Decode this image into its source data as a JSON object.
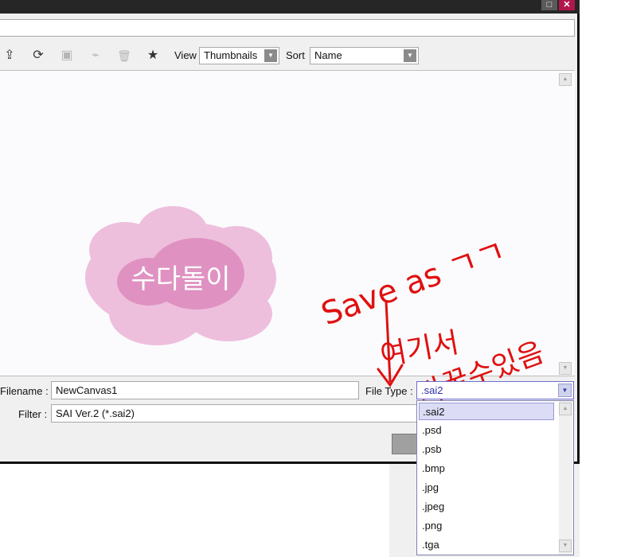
{
  "window": {
    "maximize_glyph": "□",
    "close_glyph": "✕"
  },
  "toolbar": {
    "icons": [
      {
        "name": "export-icon",
        "glyph": "⇪",
        "disabled": false
      },
      {
        "name": "refresh-icon",
        "glyph": "⟳",
        "disabled": false
      },
      {
        "name": "new-folder-icon",
        "glyph": "▣",
        "disabled": true
      },
      {
        "name": "clear-icon",
        "glyph": "⌁",
        "disabled": true
      },
      {
        "name": "trash-icon",
        "glyph": "🗑",
        "disabled": true
      },
      {
        "name": "star-icon",
        "glyph": "★",
        "disabled": false
      }
    ],
    "view_label": "View",
    "view_value": "Thumbnails",
    "sort_label": "Sort",
    "sort_value": "Name"
  },
  "thumbnail": {
    "text": "수다돌이",
    "color": "#e58fc4"
  },
  "form": {
    "filename_label": "Filename :",
    "filename_value": "NewCanvas1",
    "filetype_label": "File Type :",
    "filetype_value": ".sai2",
    "filter_label": "Filter :",
    "filter_value": "SAI Ver.2 (*.sai2)"
  },
  "dropdown": {
    "options": [
      ".sai2",
      ".psd",
      ".psb",
      ".bmp",
      ".jpg",
      ".jpeg",
      ".png",
      ".tga"
    ],
    "selected_index": 0
  },
  "annotation": {
    "line1": "Save as ㄱㄱ",
    "line2": "여기서",
    "line3": "바꿀수있음",
    "color": "#e01010"
  }
}
